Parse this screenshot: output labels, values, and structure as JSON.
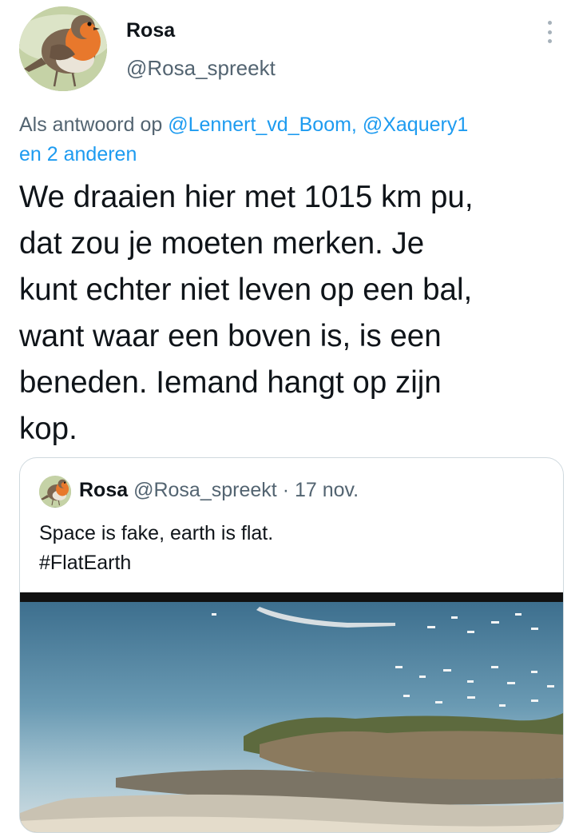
{
  "author": {
    "display_name": "Rosa",
    "handle": "@Rosa_spreekt",
    "avatar_icon": "robin-bird-avatar"
  },
  "reply_context": {
    "prefix": "Als antwoord op",
    "mention_1": "@Lennert_vd_Boom,",
    "mention_2": "@Xaquery1",
    "mention_3": "en 2 anderen"
  },
  "tweet": {
    "lines": [
      "We draaien hier met 1015 km pu,",
      "dat zou je moeten merken. Je",
      "kunt echter niet leven op een bal,",
      "want waar een boven is, is een",
      "beneden. Iemand hangt op zijn",
      "kop."
    ]
  },
  "quoted_tweet": {
    "display_name": "Rosa",
    "handle": "@Rosa_spreekt",
    "separator": "·",
    "date": "17 nov.",
    "text_line_1": "Space is fake, earth is flat.",
    "text_line_2": "#FlatEarth",
    "media_description_icon": "upside-down-coastline-photo"
  },
  "colors": {
    "link": "#1d9bf0",
    "secondary_text": "#536471",
    "primary_text": "#0f1419",
    "border": "#cfd9de"
  }
}
